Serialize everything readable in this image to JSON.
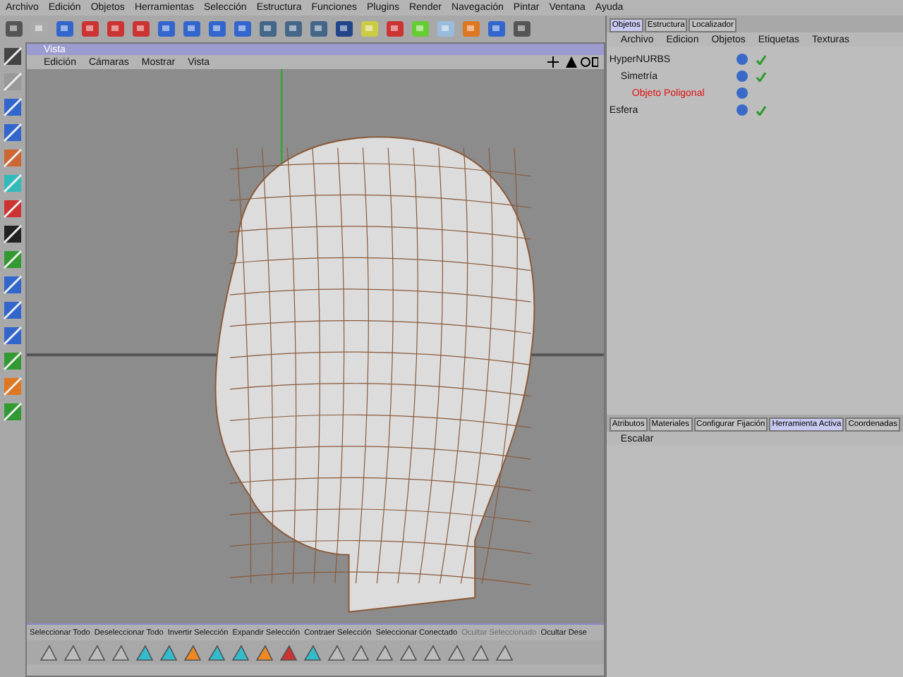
{
  "menu_bar": [
    "Archivo",
    "Edición",
    "Objetos",
    "Herramientas",
    "Selección",
    "Estructura",
    "Funciones",
    "Plugins",
    "Render",
    "Navegación",
    "Pintar",
    "Ventana",
    "Ayuda"
  ],
  "viewport": {
    "title": "Vista",
    "menu": [
      "Edición",
      "Cámaras",
      "Mostrar",
      "Vista"
    ]
  },
  "object_manager": {
    "tabs": [
      {
        "label": "Objetos",
        "selected": true
      },
      {
        "label": "Estructura",
        "selected": false
      },
      {
        "label": "Localizador",
        "selected": false
      }
    ],
    "menu": [
      "Archivo",
      "Edicion",
      "Objetos",
      "Etiquetas",
      "Texturas"
    ],
    "tree": [
      {
        "name": "HyperNURBS",
        "selected": false,
        "checked": true,
        "children": [
          {
            "name": "Simetría",
            "selected": false,
            "checked": true,
            "children": [
              {
                "name": "Objeto Poligonal",
                "selected": true,
                "checked": false
              }
            ]
          }
        ]
      },
      {
        "name": "Esfera",
        "selected": false,
        "checked": true
      }
    ]
  },
  "attribute_manager": {
    "tabs": [
      {
        "label": "Atributos",
        "selected": false
      },
      {
        "label": "Materiales",
        "selected": false
      },
      {
        "label": "Configurar Fijación",
        "selected": false
      },
      {
        "label": "Herramienta Activa",
        "selected": true
      },
      {
        "label": "Coordenadas",
        "selected": false
      }
    ],
    "tool_name": "Escalar"
  },
  "command_bar": [
    {
      "label": "Seleccionar Todo",
      "disabled": false
    },
    {
      "label": "Deseleccionar Todo",
      "disabled": false
    },
    {
      "label": "Invertir Selección",
      "disabled": false
    },
    {
      "label": "Expandir Selección",
      "disabled": false
    },
    {
      "label": "Contraer Selección",
      "disabled": false
    },
    {
      "label": "Seleccionar Conectado",
      "disabled": false
    },
    {
      "label": "Ocultar Seleccionado",
      "disabled": true
    },
    {
      "label": "Ocultar Dese",
      "disabled": false
    }
  ]
}
